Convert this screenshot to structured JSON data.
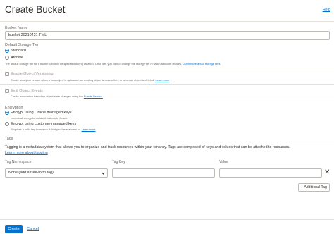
{
  "header": {
    "title": "Create Bucket",
    "help": "Help"
  },
  "bucket_name": {
    "label": "Bucket Name",
    "value": "bucket-20210421-FML"
  },
  "storage_tier": {
    "label": "Default Storage Tier",
    "options": [
      "Standard",
      "Archive"
    ],
    "selected": "Standard",
    "help": "The default storage tier for a bucket can only be specified during creation. Once set, you cannot change the storage tier in which a bucket resides.",
    "help_link": "Learn more about storage tiers"
  },
  "versioning": {
    "label": "Enable Object Versioning",
    "help": "Create an object version when a new object is uploaded, an existing object is overwritten, or when an object is deleted.",
    "help_link": "Learn more"
  },
  "events": {
    "label": "Emit Object Events",
    "help": "Create automation based on object state changes using the",
    "help_link": "Events Service."
  },
  "encryption": {
    "label": "Encryption",
    "option1": "Encrypt using Oracle managed keys",
    "option1_help": "Leaves all encryption-related matters to Oracle.",
    "option2": "Encrypt using customer-managed keys",
    "option2_help": "Requires a valid key from a vault that you have access to.",
    "option2_link": "Learn more",
    "selected": "Encrypt using Oracle managed keys"
  },
  "tags": {
    "label": "Tags",
    "description": "Tagging is a metadata system that allows you to organize and track resources within your tenancy. Tags are composed of keys and values that can be attached to resources.",
    "learn_more": "Learn more about tagging",
    "namespace_label": "Tag Namespace",
    "key_label": "Tag Key",
    "value_label": "Value",
    "namespace_value": "None (add a free-form tag)",
    "key_value": "",
    "value_value": "",
    "add_button": "+ Additional Tag",
    "remove_icon": "close-icon"
  },
  "footer": {
    "create": "Create",
    "cancel": "Cancel"
  },
  "colors": {
    "accent": "#0572ce",
    "text": "#312d2a",
    "muted": "#6a6560",
    "border": "#bfbcb8"
  }
}
